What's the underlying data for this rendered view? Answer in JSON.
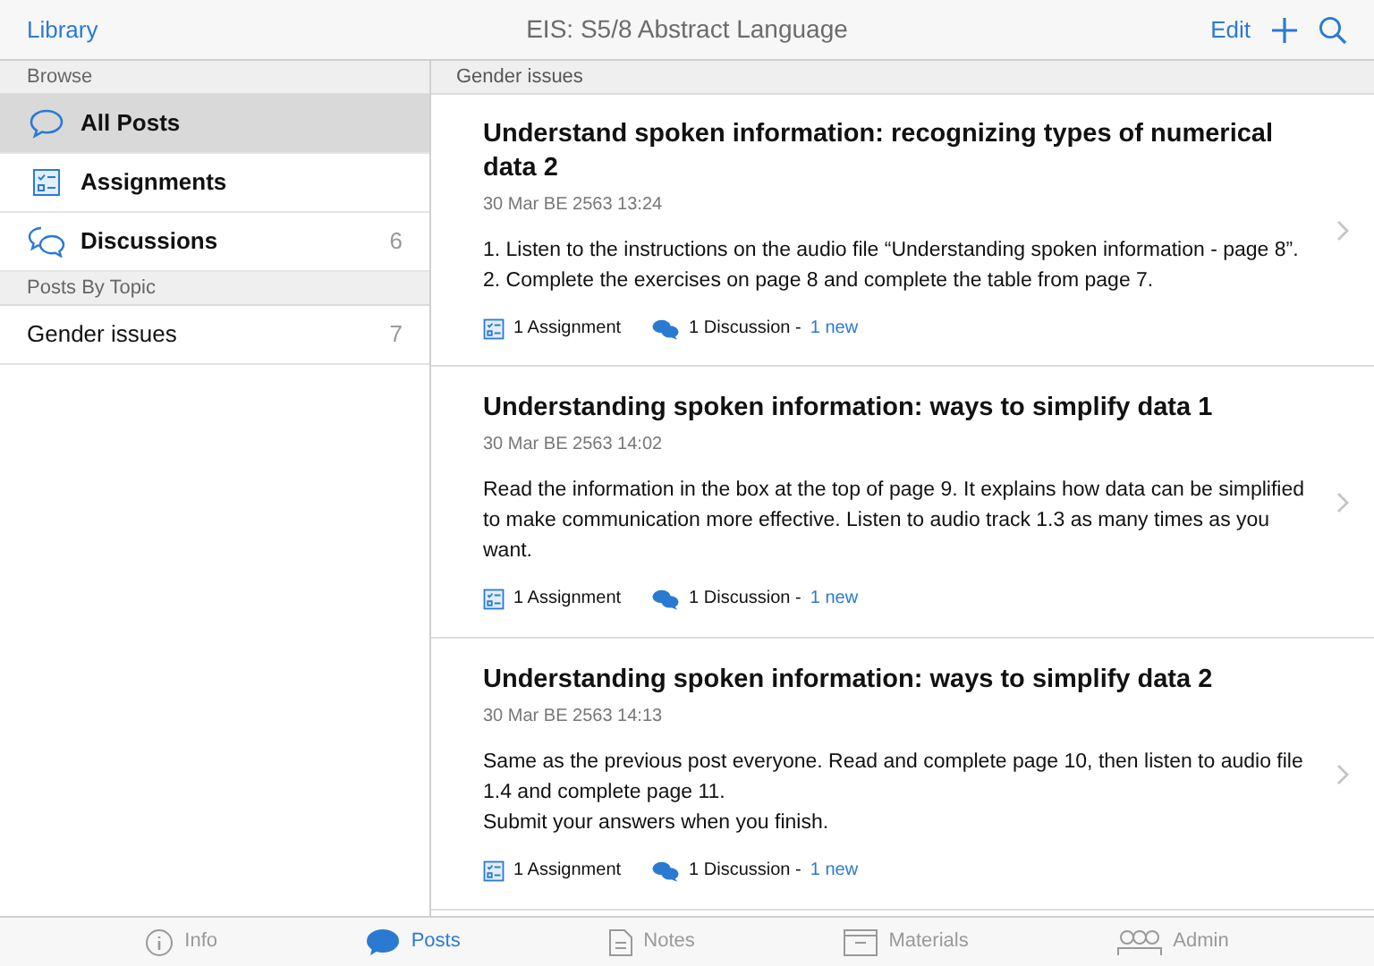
{
  "nav_bar": {
    "back": "Library",
    "title": "EIS: S5/8 Abstract Language",
    "edit": "Edit"
  },
  "sidebar": {
    "sections": [
      {
        "header": "Browse",
        "items": [
          {
            "kind": "all",
            "label": "All Posts",
            "selected": true
          },
          {
            "kind": "assignments",
            "label": "Assignments",
            "selected": false
          },
          {
            "kind": "discussions",
            "label": "Discussions",
            "count": "6",
            "selected": false
          }
        ]
      },
      {
        "header": "Posts By Topic",
        "items": [
          {
            "kind": "topic",
            "label": "Gender issues",
            "count": "7",
            "selected": false
          }
        ]
      }
    ]
  },
  "content": {
    "header": "Gender issues",
    "posts": [
      {
        "title": "Understand spoken information: recognizing types of numerical data 2",
        "date": "30 Mar BE 2563 13:24",
        "body": [
          "1. Listen to the instructions on the audio file “Understanding spoken information - page 8”.",
          "2. Complete the exercises on page 8 and complete the table from page 7."
        ],
        "assignments": "1 Assignment",
        "discussions": "1 Discussion -",
        "new": "1 new"
      },
      {
        "title": "Understanding spoken information: ways to simplify data 1",
        "date": "30 Mar BE 2563 14:02",
        "body": [
          "Read the information in the box at the top of page 9. It explains how data can be simplified to make communication more effective. Listen to audio track 1.3 as many times as you want."
        ],
        "assignments": "1 Assignment",
        "discussions": "1 Discussion -",
        "new": "1 new"
      },
      {
        "title": "Understanding spoken information: ways to simplify data 2",
        "date": "30 Mar BE 2563 14:13",
        "body": [
          "Same as the previous post everyone. Read and complete page 10, then listen to audio file 1.4 and complete page 11.",
          "Submit your answers when you finish."
        ],
        "assignments": "1 Assignment",
        "discussions": "1 Discussion -",
        "new": "1 new"
      }
    ]
  },
  "tab_bar": [
    {
      "kind": "info",
      "label": "Info",
      "selected": false
    },
    {
      "kind": "posts",
      "label": "Posts",
      "selected": true
    },
    {
      "kind": "notes",
      "label": "Notes",
      "selected": false
    },
    {
      "kind": "materials",
      "label": "Materials",
      "selected": false
    },
    {
      "kind": "admin",
      "label": "Admin",
      "selected": false
    }
  ]
}
